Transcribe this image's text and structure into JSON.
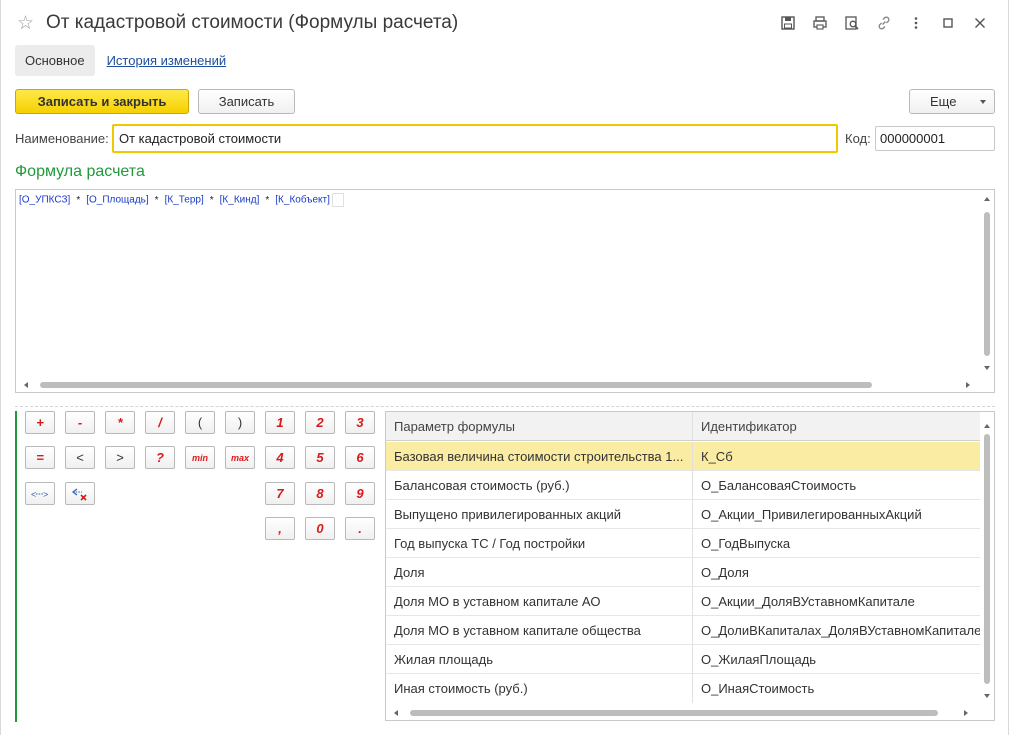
{
  "window": {
    "title": "От кадастровой стоимости (Формулы расчета)",
    "star_glyph": "☆"
  },
  "tabs": [
    {
      "label": "Основное",
      "active": true
    },
    {
      "label": "История изменений",
      "active": false
    }
  ],
  "toolbar": {
    "write_close_label": "Записать и закрыть",
    "write_label": "Записать",
    "more_label": "Еще"
  },
  "form": {
    "name_label": "Наименование:",
    "name_value": "От кадастровой стоимости",
    "code_label": "Код:",
    "code_value": "000000001"
  },
  "formula": {
    "section_title": "Формула расчета",
    "tokens": [
      "[О_УПКСЗ]",
      "[О_Площадь]",
      "[К_Терр]",
      "[К_Кинд]",
      "[К_Кобъект]"
    ],
    "operator": "*"
  },
  "calculator": {
    "buttons": [
      "+",
      "-",
      "*",
      "/",
      "(",
      ")",
      "1",
      "2",
      "3",
      "=",
      "<",
      ">",
      "?",
      "min",
      "max",
      "4",
      "5",
      "6",
      "7",
      "8",
      "9",
      ",",
      "0",
      "."
    ],
    "icons": [
      "swap-brackets-icon",
      "clear-icon"
    ]
  },
  "params_table": {
    "headers": [
      "Параметр формулы",
      "Идентификатор"
    ],
    "rows": [
      {
        "param": "Базовая величина стоимости строительства 1...",
        "id": "К_Сб",
        "selected": true
      },
      {
        "param": "Балансовая стоимость (руб.)",
        "id": "О_БалансоваяСтоимость"
      },
      {
        "param": "Выпущено привилегированных акций",
        "id": "О_Акции_ПривилегированныхАкций"
      },
      {
        "param": "Год выпуска ТС / Год постройки",
        "id": "О_ГодВыпуска"
      },
      {
        "param": "Доля",
        "id": "О_Доля"
      },
      {
        "param": "Доля МО в уставном капитале АО",
        "id": "О_Акции_ДоляВУставномКапитале"
      },
      {
        "param": "Доля МО в уставном капитале общества",
        "id": "О_ДолиВКапиталах_ДоляВУставномКапитале"
      },
      {
        "param": "Жилая площадь",
        "id": "О_ЖилаяПлощадь"
      },
      {
        "param": "Иная стоимость (руб.)",
        "id": "О_ИнаяСтоимость"
      }
    ]
  },
  "colors": {
    "accent_yellow": "#f5d000",
    "section_green": "#1f9a3a",
    "token_blue": "#1a3ac8",
    "selected_row": "#fbeca4",
    "calc_red": "#d91a1a"
  }
}
